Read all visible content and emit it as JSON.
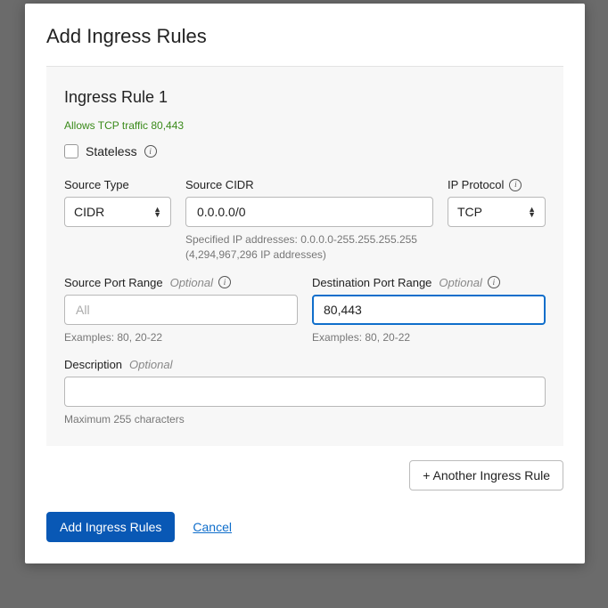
{
  "modal": {
    "title": "Add Ingress Rules"
  },
  "rule": {
    "heading": "Ingress Rule 1",
    "allows": "Allows TCP traffic 80,443",
    "stateless_label": "Stateless",
    "source_type": {
      "label": "Source Type",
      "value": "CIDR"
    },
    "source_cidr": {
      "label": "Source CIDR",
      "value": "0.0.0.0/0",
      "helper_line1": "Specified IP addresses: 0.0.0.0-255.255.255.255",
      "helper_line2": "(4,294,967,296 IP addresses)"
    },
    "ip_protocol": {
      "label": "IP Protocol",
      "value": "TCP"
    },
    "source_port": {
      "label": "Source Port Range",
      "optional": "Optional",
      "placeholder": "All",
      "helper": "Examples: 80, 20-22"
    },
    "dest_port": {
      "label": "Destination Port Range",
      "optional": "Optional",
      "value": "80,443",
      "helper": "Examples: 80, 20-22"
    },
    "description": {
      "label": "Description",
      "optional": "Optional",
      "helper": "Maximum 255 characters"
    }
  },
  "buttons": {
    "another": "+ Another Ingress Rule",
    "submit": "Add Ingress Rules",
    "cancel": "Cancel"
  }
}
